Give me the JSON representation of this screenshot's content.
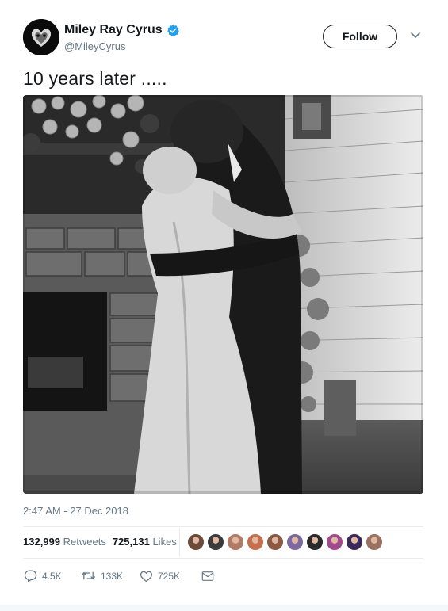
{
  "user": {
    "display_name": "Miley Ray Cyrus",
    "handle": "@MileyCyrus",
    "verified": true,
    "avatar_icon": "heart-skull-avatar"
  },
  "header": {
    "follow_label": "Follow",
    "menu_icon": "chevron-down-icon"
  },
  "tweet": {
    "text": "10 years later .....",
    "photo_description": "black-and-white wedding photo"
  },
  "meta": {
    "timestamp": "2:47 AM - 27 Dec 2018"
  },
  "stats": {
    "retweets_count": "132,999",
    "retweets_label": "Retweets",
    "likes_count": "725,131",
    "likes_label": "Likes",
    "liker_avatars": [
      "#6b4a3a",
      "#3b3b3b",
      "#b07a64",
      "#c4704f",
      "#8a5a44",
      "#7a6aa0",
      "#2a2a2a",
      "#a04a8a",
      "#3a2a5a",
      "#9a7060"
    ]
  },
  "actions": {
    "reply_count": "4.5K",
    "retweet_count": "133K",
    "like_count": "725K",
    "reply_icon": "reply-icon",
    "retweet_icon": "retweet-icon",
    "like_icon": "heart-icon",
    "dm_icon": "envelope-icon"
  },
  "colors": {
    "verified_blue": "#1da1f2",
    "muted_text": "#657786"
  }
}
